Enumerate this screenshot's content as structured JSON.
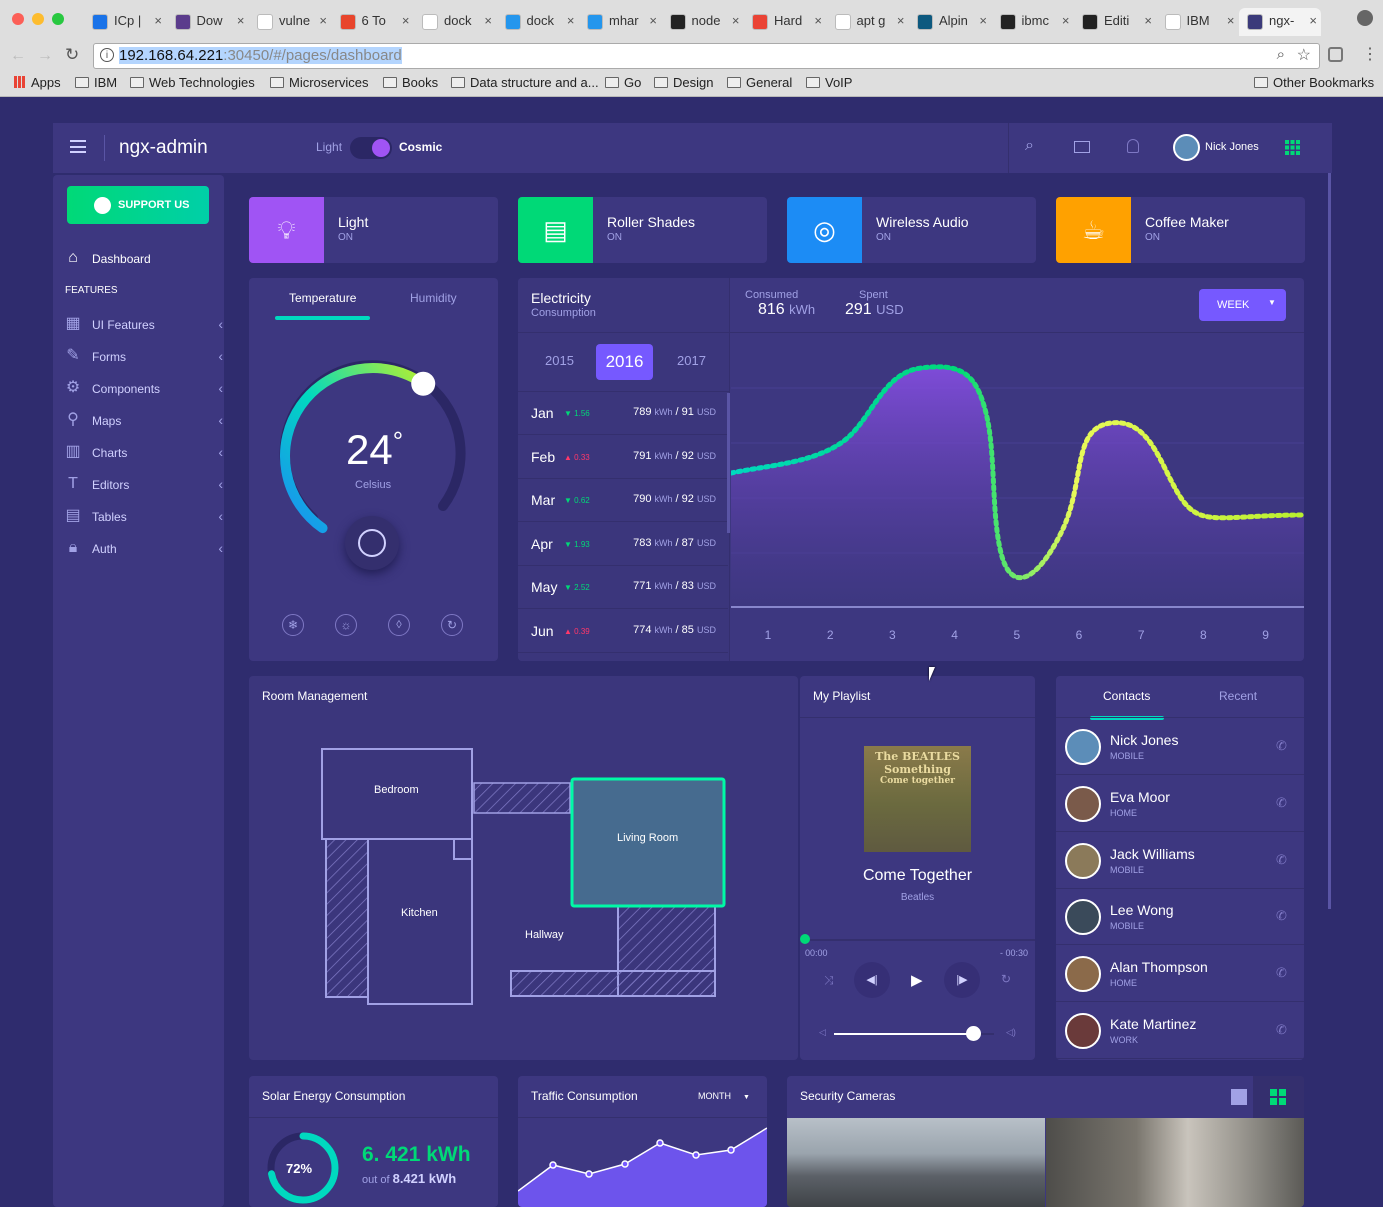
{
  "browser": {
    "tabs": [
      "ICp |",
      "Dow",
      "vulne",
      "6 To",
      "dock",
      "dock",
      "mhar",
      "node",
      "Hard",
      "apt g",
      "Alpin",
      "ibmc",
      "Editi",
      "IBM",
      "ngx-"
    ],
    "url_host": "192.168.64.221",
    "url_rest": ":30450/#/pages/dashboard",
    "apps_label": "Apps",
    "bookmarks": [
      "IBM",
      "Web Technologies",
      "Microservices",
      "Books",
      "Data structure and a...",
      "Go",
      "Design",
      "General",
      "VoIP"
    ],
    "other_bookmarks": "Other Bookmarks"
  },
  "header": {
    "brand": "ngx-admin",
    "theme_light": "Light",
    "theme_cosmic": "Cosmic",
    "user_name": "Nick Jones"
  },
  "sidebar": {
    "support": "SUPPORT US",
    "dashboard": "Dashboard",
    "section": "FEATURES",
    "items": [
      "UI Features",
      "Forms",
      "Components",
      "Maps",
      "Charts",
      "Editors",
      "Tables",
      "Auth"
    ]
  },
  "status_cards": [
    {
      "title": "Light",
      "status": "ON",
      "color": "#a054f4"
    },
    {
      "title": "Roller Shades",
      "status": "ON",
      "color": "#00d977"
    },
    {
      "title": "Wireless Audio",
      "status": "ON",
      "color": "#1c8cf5"
    },
    {
      "title": "Coffee Maker",
      "status": "ON",
      "color": "#ffa100"
    }
  ],
  "temperature": {
    "tab_temp": "Temperature",
    "tab_hum": "Humidity",
    "value": "24",
    "unit": "°",
    "scale": "Celsius",
    "level": 0.62
  },
  "electricity": {
    "title": "Electricity",
    "subtitle": "Consumption",
    "years": [
      "2015",
      "2016",
      "2017"
    ],
    "active_year": "2016",
    "months": [
      {
        "m": "Jan",
        "dir": "down",
        "delta": "1.56",
        "kwh": "789",
        "usd": "91"
      },
      {
        "m": "Feb",
        "dir": "up",
        "delta": "0.33",
        "kwh": "791",
        "usd": "92"
      },
      {
        "m": "Mar",
        "dir": "down",
        "delta": "0.62",
        "kwh": "790",
        "usd": "92"
      },
      {
        "m": "Apr",
        "dir": "down",
        "delta": "1.93",
        "kwh": "783",
        "usd": "87"
      },
      {
        "m": "May",
        "dir": "down",
        "delta": "2.52",
        "kwh": "771",
        "usd": "83"
      },
      {
        "m": "Jun",
        "dir": "up",
        "delta": "0.39",
        "kwh": "774",
        "usd": "85"
      }
    ],
    "kwh_label": "kWh",
    "usd_label": "USD",
    "consumed_label": "Consumed",
    "consumed_value": "816",
    "consumed_unit": "kWh",
    "spent_label": "Spent",
    "spent_value": "291",
    "spent_unit": "USD",
    "period": "WEEK",
    "x_ticks": [
      "1",
      "2",
      "3",
      "4",
      "5",
      "6",
      "7",
      "8",
      "9"
    ]
  },
  "rooms": {
    "title": "Room Management",
    "bedroom": "Bedroom",
    "living": "Living Room",
    "kitchen": "Kitchen",
    "hallway": "Hallway"
  },
  "playlist": {
    "title": "My Playlist",
    "album_line1": "The BEATLES",
    "album_line2": "Something",
    "album_line3": "Come together",
    "song": "Come Together",
    "artist": "Beatles",
    "time_start": "00:00",
    "time_end": "- 00:30",
    "progress": 0.0,
    "volume": 0.87
  },
  "contacts": {
    "tab_contacts": "Contacts",
    "tab_recent": "Recent",
    "list": [
      {
        "name": "Nick Jones",
        "type": "MOBILE"
      },
      {
        "name": "Eva Moor",
        "type": "HOME"
      },
      {
        "name": "Jack Williams",
        "type": "MOBILE"
      },
      {
        "name": "Lee Wong",
        "type": "MOBILE"
      },
      {
        "name": "Alan Thompson",
        "type": "HOME"
      },
      {
        "name": "Kate Martinez",
        "type": "WORK"
      }
    ]
  },
  "solar": {
    "title": "Solar Energy Consumption",
    "percent": "72%",
    "value": "6. 421 kWh",
    "out_of": "out of",
    "total": "8.421 kWh",
    "level": 0.72
  },
  "traffic": {
    "title": "Traffic Consumption",
    "period": "MONTH"
  },
  "security": {
    "title": "Security Cameras"
  },
  "chart_data": {
    "type": "area",
    "x": [
      1,
      2,
      3,
      4,
      5,
      6,
      7,
      8,
      9
    ],
    "xlabel": "",
    "ylabel": "",
    "grid": true
  }
}
